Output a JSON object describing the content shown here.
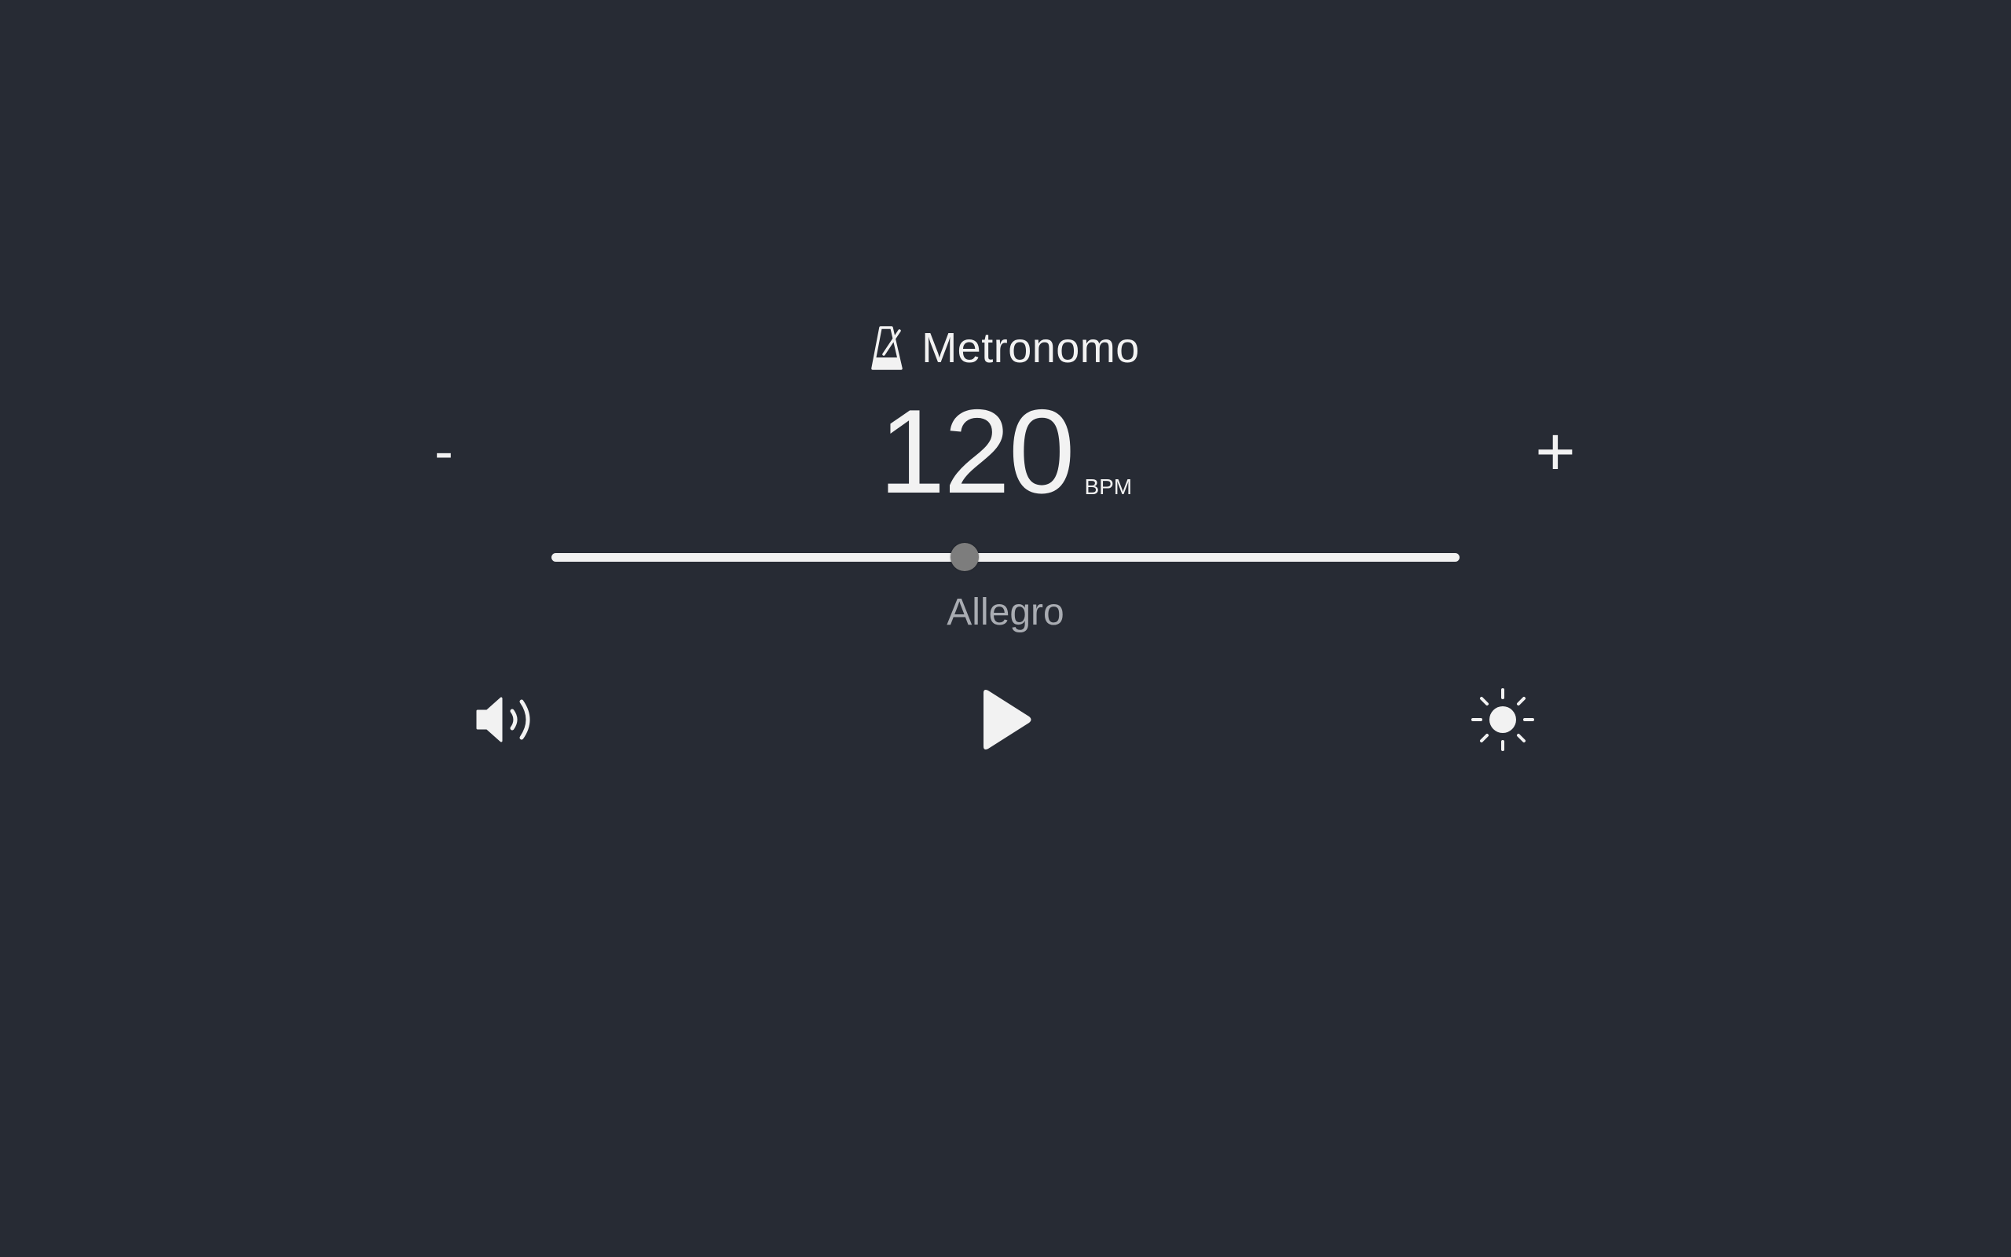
{
  "header": {
    "title": "Metronomo",
    "icon": "metronome-icon"
  },
  "tempo": {
    "bpm": "120",
    "unit": "BPM",
    "name": "Allegro",
    "slider_fraction": 0.455
  },
  "controls": {
    "decrease_label": "-",
    "increase_label": "+",
    "volume_icon": "volume-icon",
    "play_icon": "play-icon",
    "theme_icon": "sun-icon"
  },
  "colors": {
    "background": "#272b34",
    "foreground": "#f2f2f2",
    "thumb": "#7d7d7d",
    "muted_text": "#a9acb2"
  }
}
